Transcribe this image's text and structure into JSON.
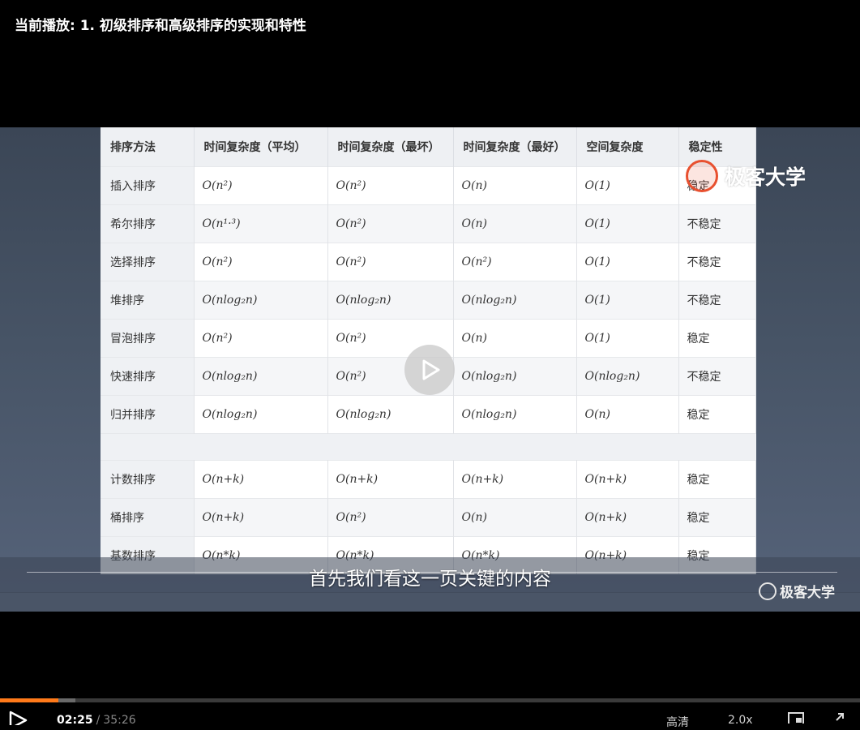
{
  "header": {
    "now_playing": "当前播放: 1. 初级排序和高级排序的实现和特性"
  },
  "slide": {
    "columns": [
      "排序方法",
      "时间复杂度（平均）",
      "时间复杂度（最坏）",
      "时间复杂度（最好）",
      "空间复杂度",
      "稳定性"
    ],
    "rows": [
      {
        "name": "插入排序",
        "avg": "O(n²)",
        "worst": "O(n²)",
        "best": "O(n)",
        "space": "O(1)",
        "stable": "稳定"
      },
      {
        "name": "希尔排序",
        "avg": "O(n¹·³)",
        "worst": "O(n²)",
        "best": "O(n)",
        "space": "O(1)",
        "stable": "不稳定"
      },
      {
        "name": "选择排序",
        "avg": "O(n²)",
        "worst": "O(n²)",
        "best": "O(n²)",
        "space": "O(1)",
        "stable": "不稳定"
      },
      {
        "name": "堆排序",
        "avg": "O(nlog₂n)",
        "worst": "O(nlog₂n)",
        "best": "O(nlog₂n)",
        "space": "O(1)",
        "stable": "不稳定"
      },
      {
        "name": "冒泡排序",
        "avg": "O(n²)",
        "worst": "O(n²)",
        "best": "O(n)",
        "space": "O(1)",
        "stable": "稳定"
      },
      {
        "name": "快速排序",
        "avg": "O(nlog₂n)",
        "worst": "O(n²)",
        "best": "O(nlog₂n)",
        "space": "O(nlog₂n)",
        "stable": "不稳定"
      },
      {
        "name": "归并排序",
        "avg": "O(nlog₂n)",
        "worst": "O(nlog₂n)",
        "best": "O(nlog₂n)",
        "space": "O(n)",
        "stable": "稳定"
      },
      {
        "name": "计数排序",
        "avg": "O(n+k)",
        "worst": "O(n+k)",
        "best": "O(n+k)",
        "space": "O(n+k)",
        "stable": "稳定"
      },
      {
        "name": "桶排序",
        "avg": "O(n+k)",
        "worst": "O(n²)",
        "best": "O(n)",
        "space": "O(n+k)",
        "stable": "稳定"
      },
      {
        "name": "基数排序",
        "avg": "O(n*k)",
        "worst": "O(n*k)",
        "best": "O(n*k)",
        "space": "O(n+k)",
        "stable": "稳定"
      }
    ],
    "watermark_top": "极客大学"
  },
  "overlay": {
    "subtitle": "首先我们看这一页关键的内容",
    "watermark_bottom": "极客大学"
  },
  "player": {
    "current_time": "02:25",
    "separator": "/",
    "duration": "35:26",
    "quality": "高清",
    "speed": "2.0x",
    "played_fraction": 0.068,
    "buffered_fraction": 0.088,
    "accent_color": "#ff7a1a"
  }
}
